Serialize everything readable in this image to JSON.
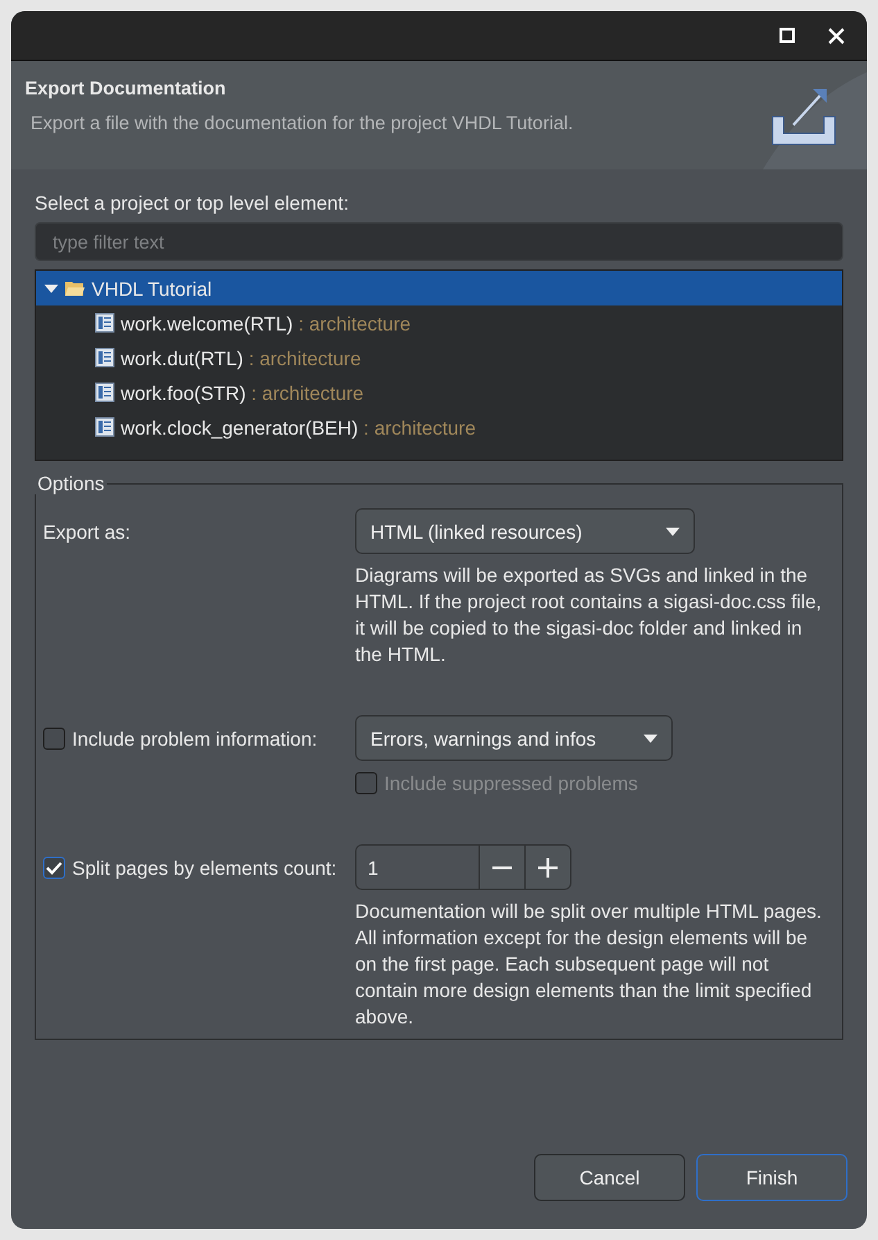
{
  "window": {
    "controls": [
      {
        "kind": "maximize"
      },
      {
        "kind": "close"
      }
    ]
  },
  "header": {
    "title": "Export Documentation",
    "description": "Export a file with the documentation for the project VHDL Tutorial."
  },
  "selection": {
    "label": "Select a project or top level element:",
    "filter": {
      "placeholder": "type filter text"
    },
    "tree": [
      {
        "label": "VHDL Tutorial",
        "expanded": true,
        "selected": true,
        "children": [
          {
            "label": "work.welcome(RTL)",
            "type": " : architecture",
            "selected": false
          },
          {
            "label": "work.dut(RTL)",
            "type": " : architecture",
            "selected": false
          },
          {
            "label": "work.foo(STR)",
            "type": " : architecture",
            "selected": false
          },
          {
            "label": "work.clock_generator(BEH)",
            "type": " : architecture",
            "selected": false
          }
        ]
      }
    ]
  },
  "options": {
    "title": "Options",
    "export_as": {
      "label": "Export as:",
      "value": "HTML (linked resources)",
      "help": "Diagrams will be exported as SVGs and linked in the HTML. If the project root contains a sigasi-doc.css file, it will be copied to the sigasi-doc folder and linked in the HTML."
    },
    "problems": {
      "label": "Include problem information:",
      "checked": false,
      "value": "Errors, warnings and infos",
      "suppressed": {
        "label": "Include suppressed problems",
        "checked": false,
        "disabled": true
      }
    },
    "split": {
      "label": "Split pages by elements count:",
      "checked": true,
      "value": "1",
      "help": "Documentation will be split over multiple HTML pages. All information except for the design elements will be on the first page. Each subsequent page will not contain more design elements than the limit specified above."
    }
  },
  "buttons": [
    {
      "label": "Cancel",
      "default": false
    },
    {
      "label": "Finish",
      "default": true
    }
  ]
}
